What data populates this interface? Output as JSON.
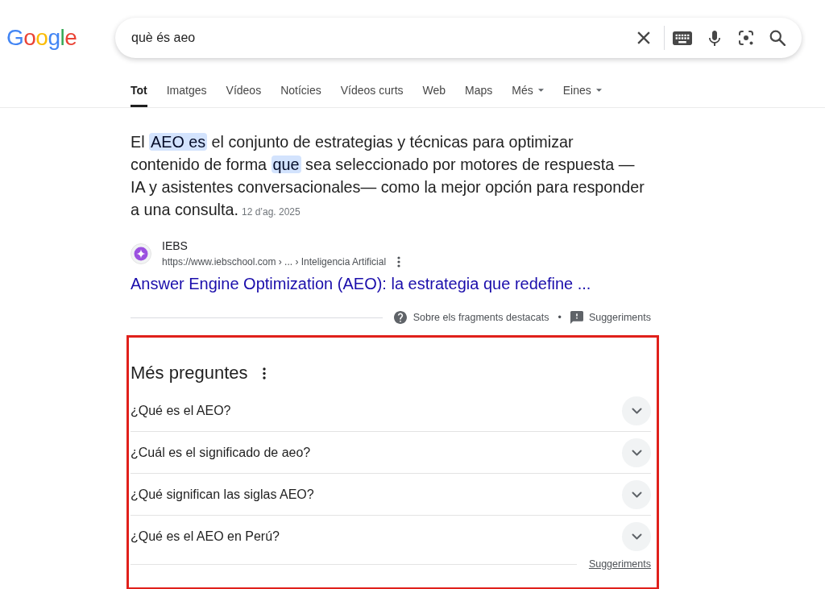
{
  "logo": {
    "text": "Google"
  },
  "search": {
    "value": "què és aeo"
  },
  "tabs": [
    {
      "label": "Tot",
      "selected": true,
      "kind": "link"
    },
    {
      "label": "Imatges",
      "selected": false,
      "kind": "link"
    },
    {
      "label": "Vídeos",
      "selected": false,
      "kind": "link"
    },
    {
      "label": "Notícies",
      "selected": false,
      "kind": "link"
    },
    {
      "label": "Vídeos curts",
      "selected": false,
      "kind": "link"
    },
    {
      "label": "Web",
      "selected": false,
      "kind": "link"
    },
    {
      "label": "Maps",
      "selected": false,
      "kind": "link"
    },
    {
      "label": "Més",
      "selected": false,
      "kind": "menu"
    },
    {
      "label": "Eines",
      "selected": false,
      "kind": "menu"
    }
  ],
  "featured_snippet": {
    "answer": [
      {
        "text": "El ",
        "highlighted": false
      },
      {
        "text": "AEO es",
        "highlighted": true
      },
      {
        "text": " el conjunto de estrategias y técnicas para optimizar contenido de forma ",
        "highlighted": false
      },
      {
        "text": "que",
        "highlighted": true
      },
      {
        "text": " sea seleccionado por motores de respuesta —IA y asistentes conversacionales— como la mejor opción para responder a una consulta.",
        "highlighted": false
      }
    ],
    "date": "12 d’ag. 2025",
    "source": {
      "name": "IEBS",
      "url": "https://www.iebschool.com › ... › Inteligencia Artificial",
      "title": "Answer Engine Optimization (AEO): la estrategia que redefine ..."
    },
    "about_link": "Sobre els fragments destacats",
    "separator": "•",
    "feedback_link": "Suggeriments"
  },
  "people_also_ask": {
    "highlighted": true,
    "title": "Més preguntes",
    "questions": [
      {
        "text": "¿Qué es el AEO?",
        "expanded": false
      },
      {
        "text": "¿Cuál es el significado de aeo?",
        "expanded": false
      },
      {
        "text": "¿Qué significan las siglas AEO?",
        "expanded": false
      },
      {
        "text": "¿Qué es el AEO en Perú?",
        "expanded": false
      }
    ],
    "feedback_link": "Suggeriments"
  }
}
